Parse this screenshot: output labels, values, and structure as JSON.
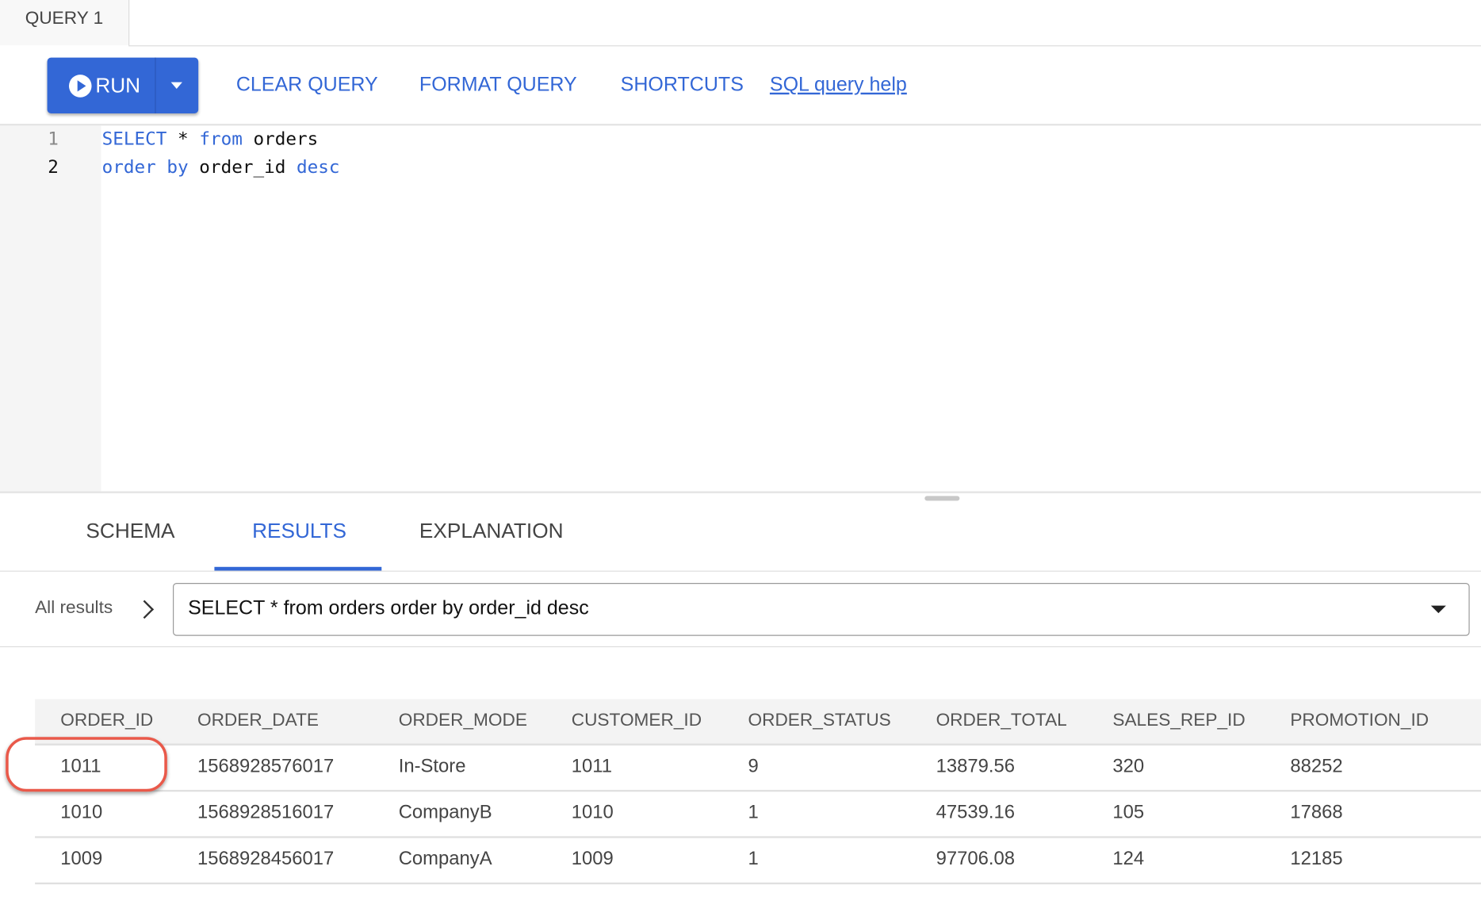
{
  "query_tab": {
    "label": "QUERY 1"
  },
  "toolbar": {
    "run_label": "RUN",
    "clear_label": "CLEAR QUERY",
    "format_label": "FORMAT QUERY",
    "shortcuts_label": "SHORTCUTS",
    "help_label": "SQL query help",
    "accent_color": "#3367d6"
  },
  "editor": {
    "lines": [
      {
        "number": "1",
        "tokens": [
          {
            "t": "SELECT",
            "kw": true
          },
          {
            "t": " * ",
            "kw": false
          },
          {
            "t": "from",
            "kw": true
          },
          {
            "t": " orders",
            "kw": false
          }
        ]
      },
      {
        "number": "2",
        "tokens": [
          {
            "t": "order by",
            "kw": true
          },
          {
            "t": " order_id ",
            "kw": false
          },
          {
            "t": "desc",
            "kw": true
          }
        ]
      }
    ]
  },
  "result_tabs": [
    {
      "label": "SCHEMA",
      "active": false
    },
    {
      "label": "RESULTS",
      "active": true
    },
    {
      "label": "EXPLANATION",
      "active": false
    }
  ],
  "results_nav": {
    "all_results": "All results",
    "selected_query": "SELECT * from orders order by order_id desc"
  },
  "table": {
    "columns": [
      "ORDER_ID",
      "ORDER_DATE",
      "ORDER_MODE",
      "CUSTOMER_ID",
      "ORDER_STATUS",
      "ORDER_TOTAL",
      "SALES_REP_ID",
      "PROMOTION_ID"
    ],
    "rows": [
      [
        "1011",
        "1568928576017",
        "In-Store",
        "1011",
        "9",
        "13879.56",
        "320",
        "88252"
      ],
      [
        "1010",
        "1568928516017",
        "CompanyB",
        "1010",
        "1",
        "47539.16",
        "105",
        "17868"
      ],
      [
        "1009",
        "1568928456017",
        "CompanyA",
        "1009",
        "1",
        "97706.08",
        "124",
        "12185"
      ]
    ]
  },
  "annotation": {
    "highlight_color": "#e9594a"
  }
}
